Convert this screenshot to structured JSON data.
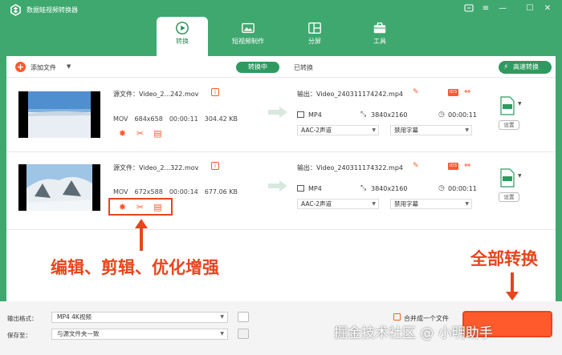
{
  "app": {
    "title": "数据蛙视频转换器"
  },
  "window_controls": {
    "menu": "≡",
    "minimize": "—",
    "maximize": "☐",
    "close": "✕"
  },
  "tabs": [
    {
      "label": "转换",
      "active": true
    },
    {
      "label": "短视频制作",
      "active": false
    },
    {
      "label": "分屏",
      "active": false
    },
    {
      "label": "工具",
      "active": false
    }
  ],
  "toolbar": {
    "add_files": "添加文件",
    "converting": "转换中",
    "converted": "已转换",
    "fast_convert": "高速转换"
  },
  "files": [
    {
      "source": "源文件：Video_2...242.mov",
      "format": "MOV",
      "resolution": "684x658",
      "duration": "00:00:11",
      "size": "304.42 KB",
      "output": "输出：Video_240311174242.mp4",
      "out_format": "MP4",
      "out_resolution": "3840x2160",
      "out_duration": "00:00:11",
      "audio": "AAC-2声道",
      "subtitle": "禁用字幕",
      "settings": "设置",
      "badge": "ID3"
    },
    {
      "source": "源文件：Video_2...322.mov",
      "format": "MOV",
      "resolution": "672x588",
      "duration": "00:00:14",
      "size": "677.06 KB",
      "output": "输出：Video_240311174322.mp4",
      "out_format": "MP4",
      "out_resolution": "3840x2160",
      "out_duration": "00:00:11",
      "audio": "AAC-2声道",
      "subtitle": "禁用字幕",
      "settings": "设置",
      "badge": "ID3"
    }
  ],
  "bottom": {
    "output_format_label": "输出格式：",
    "output_format_value": "MP4 4K视频",
    "save_to_label": "保存至：",
    "save_to_value": "与源文件夹一致",
    "merge_label": "合并成一个文件"
  },
  "annotations": {
    "edit_tools": "编辑、剪辑、优化增强",
    "convert_all": "全部转换"
  },
  "watermark": "掘金技术社区 @ 小明助手",
  "colors": {
    "accent": "#3fa86f",
    "orange": "#ff5a2b",
    "annotation": "#e8451e"
  }
}
